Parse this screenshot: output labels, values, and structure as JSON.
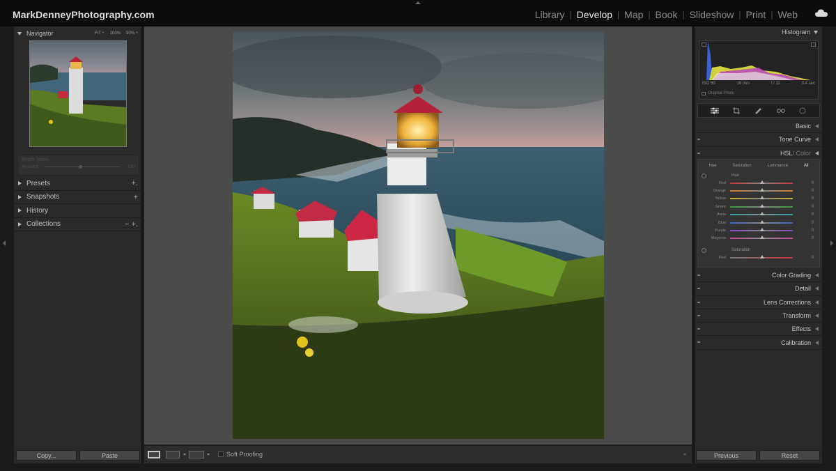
{
  "brand": "MarkDenneyPhotography.com",
  "modules": [
    "Library",
    "Develop",
    "Map",
    "Book",
    "Slideshow",
    "Print",
    "Web"
  ],
  "active_module": "Develop",
  "left_panel": {
    "navigator": {
      "title": "Navigator",
      "zoom": [
        "FIT ÷",
        "100%",
        "50% ÷"
      ]
    },
    "brush": {
      "title": "Brush: Mask",
      "amount_label": "Amount",
      "amount_value": "100"
    },
    "panels": [
      {
        "label": "Presets",
        "action": "+."
      },
      {
        "label": "Snapshots",
        "action": "+"
      },
      {
        "label": "History",
        "action": ""
      },
      {
        "label": "Collections",
        "action": "− +."
      }
    ],
    "copy_label": "Copy...",
    "paste_label": "Paste"
  },
  "center": {
    "toolbar": {
      "soft_proofing": "Soft Proofing"
    }
  },
  "right_panel": {
    "histogram_title": "Histogram",
    "histo_info": {
      "iso": "ISO 50",
      "focal": "16 mm",
      "aperture": "f / 11",
      "shutter": "0.4 sec"
    },
    "original_photo": "Original Photo",
    "sections_top": [
      "Basic",
      "Tone Curve"
    ],
    "hsl": {
      "title_a": "HSL",
      "title_b": " / Color",
      "tabs": [
        "Hue",
        "Saturation",
        "Luminance",
        "All"
      ],
      "active_tab": "All",
      "hue_label": "Hue",
      "rows": [
        {
          "label": "Red",
          "value": "0"
        },
        {
          "label": "Orange",
          "value": "0"
        },
        {
          "label": "Yellow",
          "value": "0"
        },
        {
          "label": "Green",
          "value": "0"
        },
        {
          "label": "Aqua",
          "value": "0"
        },
        {
          "label": "Blue",
          "value": "0"
        },
        {
          "label": "Purple",
          "value": "0"
        },
        {
          "label": "Magenta",
          "value": "0"
        }
      ],
      "saturation_label": "Saturation",
      "sat_rows": [
        {
          "label": "Red",
          "value": "0"
        }
      ]
    },
    "sections_bottom": [
      "Color Grading",
      "Detail",
      "Lens Corrections",
      "Transform",
      "Effects",
      "Calibration"
    ],
    "previous_label": "Previous",
    "reset_label": "Reset"
  },
  "colors": {
    "hue_tracks": [
      "#c43a3a",
      "#d07a2a",
      "#c9b42a",
      "#3c9a3c",
      "#2fa7a7",
      "#3a5fc9",
      "#8a4ac9",
      "#c44a9a"
    ]
  }
}
